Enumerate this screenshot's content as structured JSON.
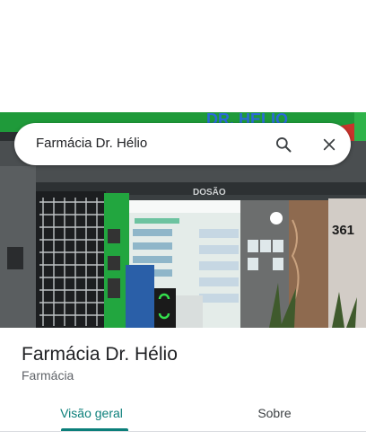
{
  "search": {
    "query": "Farmácia Dr. Hélio",
    "search_icon": "search-icon",
    "close_icon": "close-icon"
  },
  "photo": {
    "sign_text": "DR. HÉLIO",
    "address_number": "361",
    "storefront_banner": "DOSÃO"
  },
  "place": {
    "name": "Farmácia Dr. Hélio",
    "category": "Farmácia"
  },
  "tabs": [
    {
      "label": "Visão geral",
      "active": true
    },
    {
      "label": "Sobre",
      "active": false
    }
  ],
  "colors": {
    "accent": "#0b7f7a",
    "sign_green": "#1f9a3a"
  }
}
